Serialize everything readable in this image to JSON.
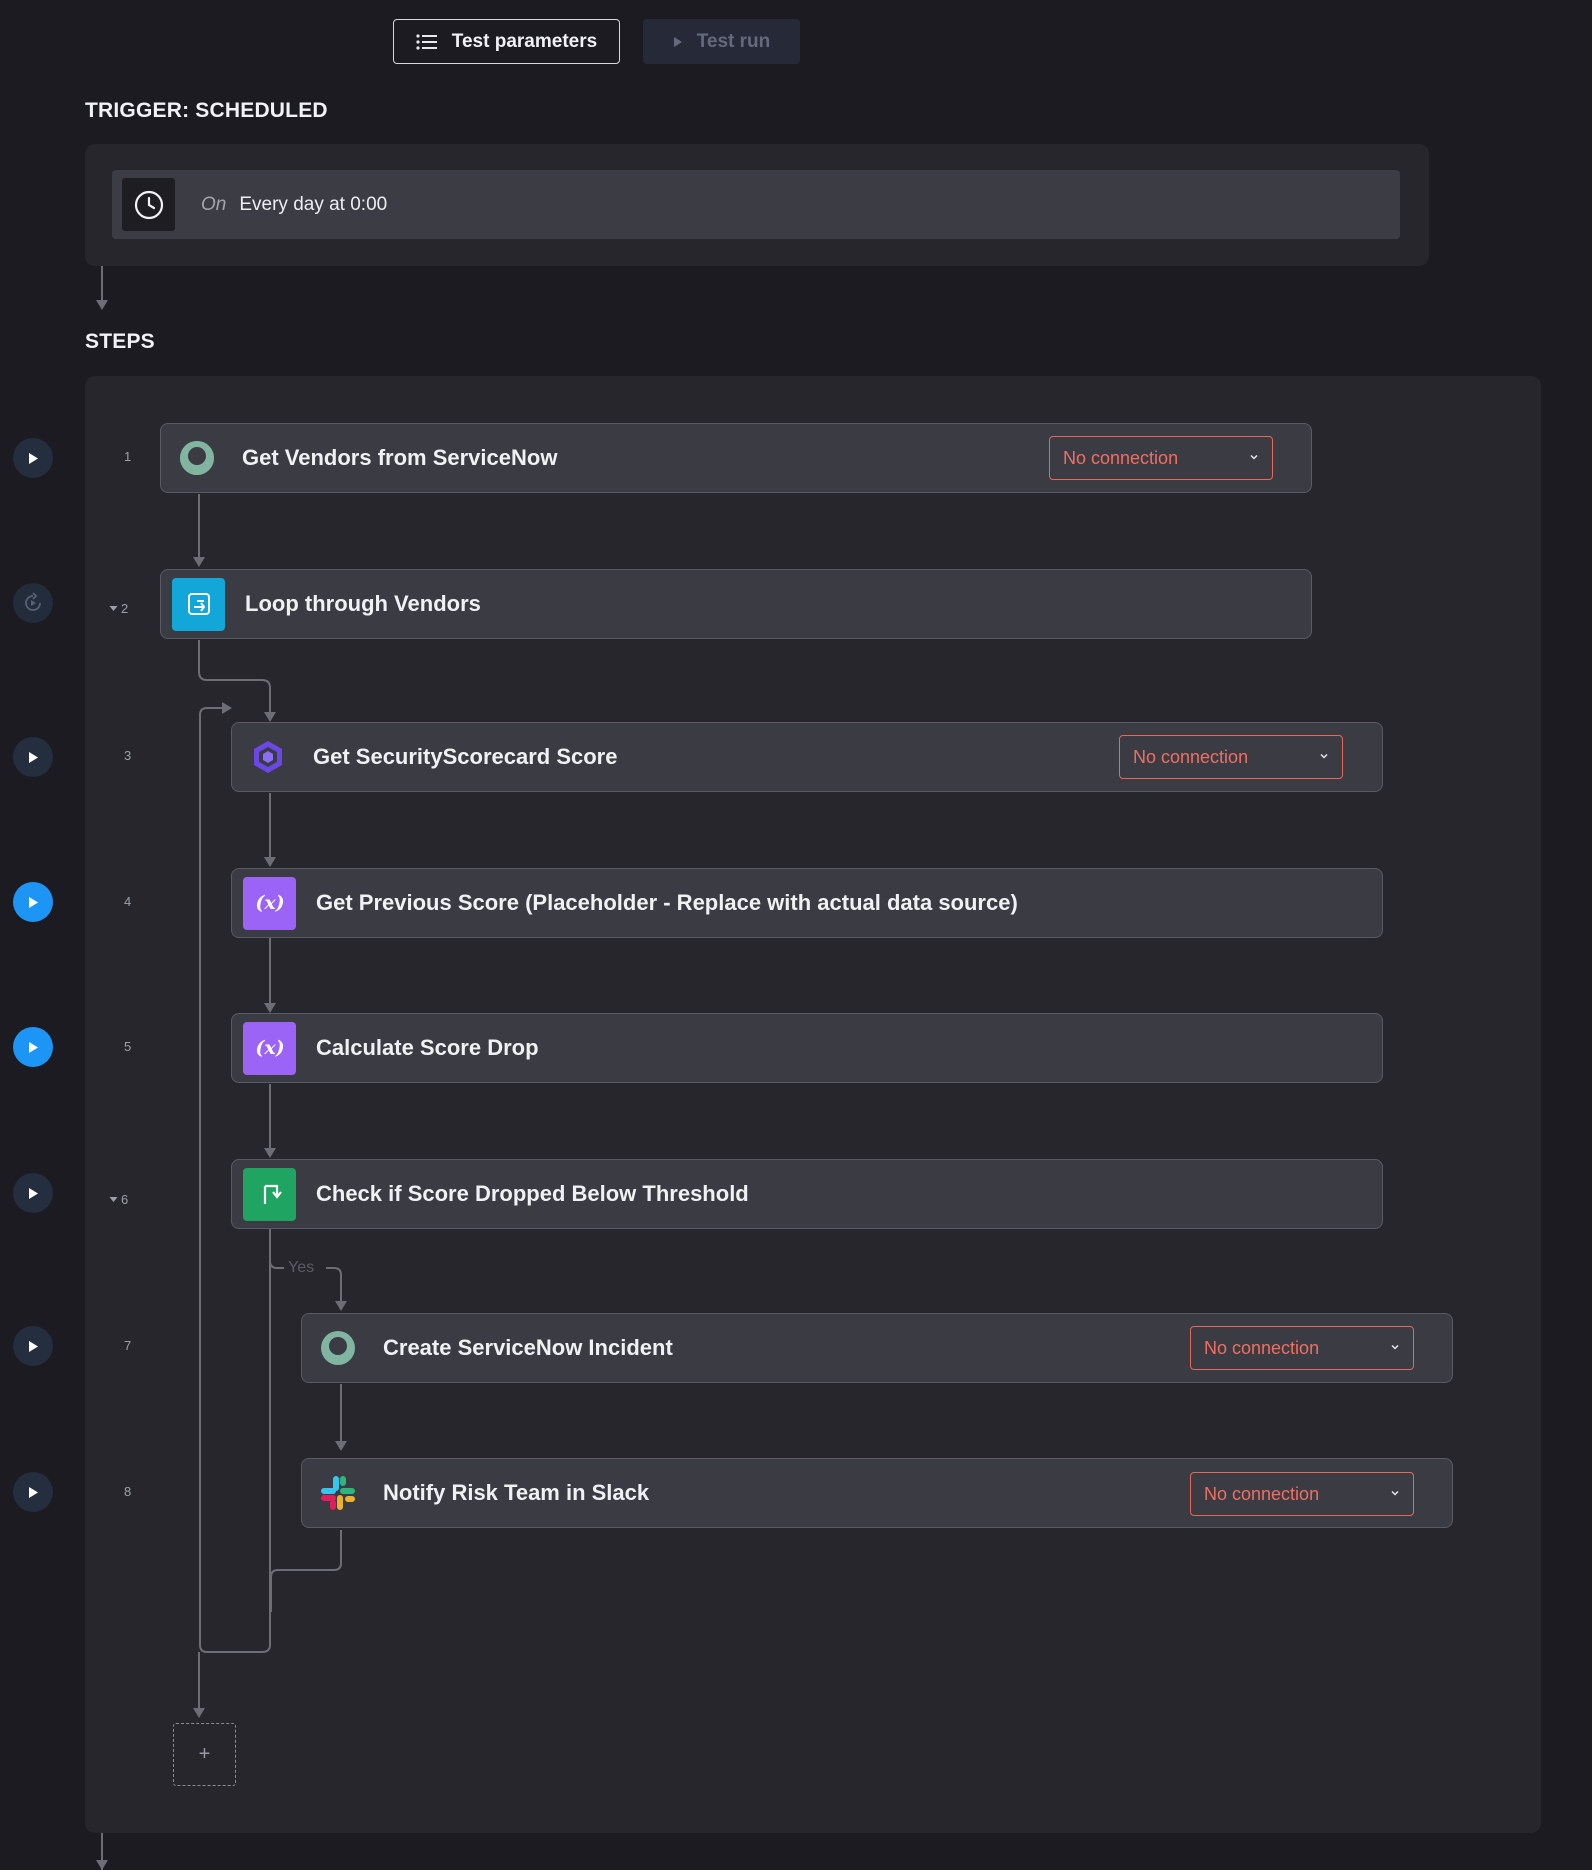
{
  "toolbar": {
    "test_parameters_label": "Test parameters",
    "test_run_label": "Test run"
  },
  "trigger": {
    "section_title": "TRIGGER: SCHEDULED",
    "on_label": "On",
    "schedule": "Every day at 0:00"
  },
  "steps_section": {
    "title": "STEPS",
    "add_label": "+",
    "branch_yes_label": "Yes"
  },
  "steps": [
    {
      "number": "1",
      "title": "Get Vendors from ServiceNow",
      "connection": "No connection",
      "icon": "servicenow-icon",
      "expandable": false
    },
    {
      "number": "2",
      "title": "Loop through Vendors",
      "connection": null,
      "icon": "loop-icon",
      "expandable": true
    },
    {
      "number": "3",
      "title": "Get SecurityScorecard Score",
      "connection": "No connection",
      "icon": "securityscorecard-icon",
      "expandable": false
    },
    {
      "number": "4",
      "title": "Get Previous Score (Placeholder - Replace with actual data source)",
      "connection": null,
      "icon": "variable-icon",
      "expandable": false
    },
    {
      "number": "5",
      "title": "Calculate Score Drop",
      "connection": null,
      "icon": "variable-icon",
      "expandable": false
    },
    {
      "number": "6",
      "title": "Check if Score Dropped Below Threshold",
      "connection": null,
      "icon": "branch-icon",
      "expandable": true
    },
    {
      "number": "7",
      "title": "Create ServiceNow Incident",
      "connection": "No connection",
      "icon": "servicenow-icon",
      "expandable": false
    },
    {
      "number": "8",
      "title": "Notify Risk Team in Slack",
      "connection": "No connection",
      "icon": "slack-icon",
      "expandable": false
    }
  ],
  "colors": {
    "background": "#1b1b21",
    "panel": "#26262c",
    "card": "#3b3b43",
    "connection_warning": "#ef6f62",
    "play_active": "#1d95f5",
    "loop_icon_bg": "#12a7d8",
    "variable_icon_bg": "#9b64f6",
    "branch_icon_bg": "#1fa561"
  }
}
